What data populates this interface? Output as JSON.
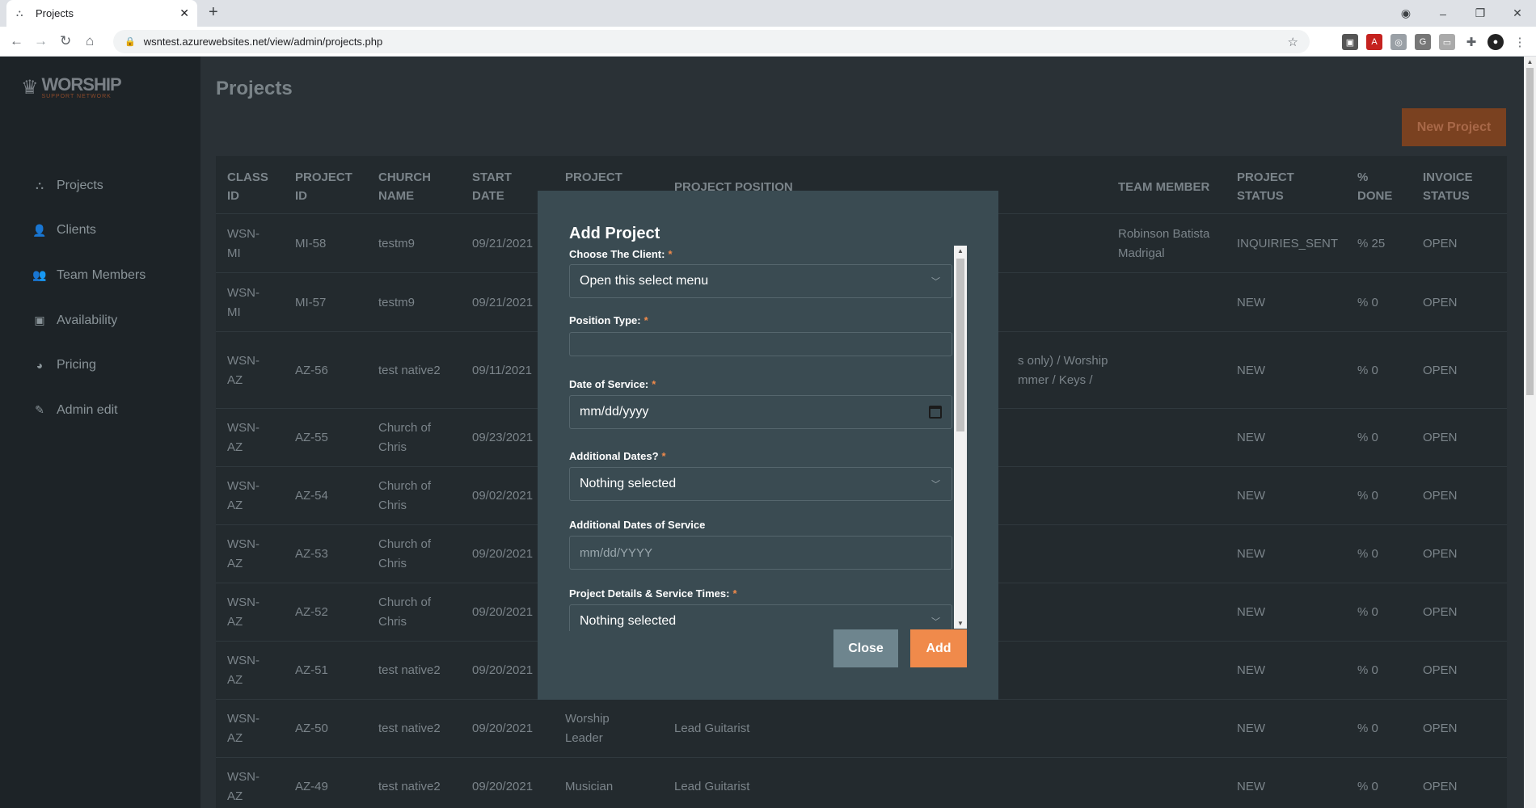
{
  "browser": {
    "tab_title": "Projects",
    "tab_close": "✕",
    "new_tab": "+",
    "url": "wsntest.azurewebsites.net/view/admin/projects.php",
    "win_minimize": "–",
    "win_restore": "❐",
    "win_close": "✕"
  },
  "logo": {
    "name": "WORSHIP",
    "tagline": "SUPPORT NETWORK"
  },
  "sidebar": {
    "items": [
      {
        "label": "Projects",
        "icon": "project-diagram-icon",
        "glyph": "⛬"
      },
      {
        "label": "Clients",
        "icon": "user-icon",
        "glyph": "👤"
      },
      {
        "label": "Team Members",
        "icon": "users-icon",
        "glyph": "👥"
      },
      {
        "label": "Availability",
        "icon": "calendar-icon",
        "glyph": "▣"
      },
      {
        "label": "Pricing",
        "icon": "pie-chart-icon",
        "glyph": "◕"
      },
      {
        "label": "Admin edit",
        "icon": "pencil-icon",
        "glyph": "✎"
      }
    ]
  },
  "page": {
    "title": "Projects",
    "new_project_label": "New Project"
  },
  "table": {
    "headers": {
      "class_id": "CLASS ID",
      "project_id": "PROJECT ID",
      "church_name": "CHURCH NAME",
      "start_date": "START DATE",
      "project": "PROJECT",
      "project_position": "PROJECT POSITION",
      "team_member": "TEAM MEMBER",
      "project_status": "PROJECT STATUS",
      "percent_done": "% DONE",
      "invoice_status": "INVOICE STATUS"
    },
    "rows": [
      {
        "class_id": "WSN-MI",
        "project_id": "MI-58",
        "church_name": "testm9",
        "start_date": "09/21/2021",
        "project": "",
        "position": "",
        "team_member": "Robinson Batista Madrigal",
        "status": "INQUIRIES_SENT",
        "done": "% 25",
        "invoice": "OPEN"
      },
      {
        "class_id": "WSN-MI",
        "project_id": "MI-57",
        "church_name": "testm9",
        "start_date": "09/21/2021",
        "project": "",
        "position": "",
        "team_member": "",
        "status": "NEW",
        "done": "% 0",
        "invoice": "OPEN"
      },
      {
        "class_id": "WSN-AZ",
        "project_id": "AZ-56",
        "church_name": "test native2",
        "start_date": "09/11/2021",
        "project": "",
        "position": "s only) / Worship mmer / Keys /",
        "team_member": "",
        "status": "NEW",
        "done": "% 0",
        "invoice": "OPEN"
      },
      {
        "class_id": "WSN-AZ",
        "project_id": "AZ-55",
        "church_name": "Church of Chris",
        "start_date": "09/23/2021",
        "project": "",
        "position": "",
        "team_member": "",
        "status": "NEW",
        "done": "% 0",
        "invoice": "OPEN"
      },
      {
        "class_id": "WSN-AZ",
        "project_id": "AZ-54",
        "church_name": "Church of Chris",
        "start_date": "09/02/2021",
        "project": "",
        "position": "",
        "team_member": "",
        "status": "NEW",
        "done": "% 0",
        "invoice": "OPEN"
      },
      {
        "class_id": "WSN-AZ",
        "project_id": "AZ-53",
        "church_name": "Church of Chris",
        "start_date": "09/20/2021",
        "project": "",
        "position": "",
        "team_member": "",
        "status": "NEW",
        "done": "% 0",
        "invoice": "OPEN"
      },
      {
        "class_id": "WSN-AZ",
        "project_id": "AZ-52",
        "church_name": "Church of Chris",
        "start_date": "09/20/2021",
        "project": "",
        "position": "",
        "team_member": "",
        "status": "NEW",
        "done": "% 0",
        "invoice": "OPEN"
      },
      {
        "class_id": "WSN-AZ",
        "project_id": "AZ-51",
        "church_name": "test native2",
        "start_date": "09/20/2021",
        "project": "",
        "position": "",
        "team_member": "",
        "status": "NEW",
        "done": "% 0",
        "invoice": "OPEN"
      },
      {
        "class_id": "WSN-AZ",
        "project_id": "AZ-50",
        "church_name": "test native2",
        "start_date": "09/20/2021",
        "project": "Worship Leader",
        "position": "Lead Guitarist",
        "team_member": "",
        "status": "NEW",
        "done": "% 0",
        "invoice": "OPEN"
      },
      {
        "class_id": "WSN-AZ",
        "project_id": "AZ-49",
        "church_name": "test native2",
        "start_date": "09/20/2021",
        "project": "Musician",
        "position": "Lead Guitarist",
        "team_member": "",
        "status": "NEW",
        "done": "% 0",
        "invoice": "OPEN"
      }
    ]
  },
  "modal": {
    "title": "Add Project",
    "client_label": "Choose The Client:",
    "client_value": "Open this select menu",
    "position_type_label": "Position Type:",
    "position_type_value": "",
    "date_label": "Date of Service:",
    "date_value": "mm/dd/yyyy",
    "additional_dates_label": "Additional Dates?",
    "additional_dates_value": "Nothing selected",
    "additional_dates_service_label": "Additional Dates of Service",
    "additional_dates_service_placeholder": "mm/dd/YYYY",
    "details_label": "Project Details & Service Times:",
    "details_value": "Nothing selected",
    "required_mark": "*",
    "close_label": "Close",
    "add_label": "Add"
  },
  "colors": {
    "accent": "#f08a4b",
    "modal_bg": "#3a4b52",
    "sidebar_bg": "#1d2327",
    "main_bg": "#2a3136"
  }
}
